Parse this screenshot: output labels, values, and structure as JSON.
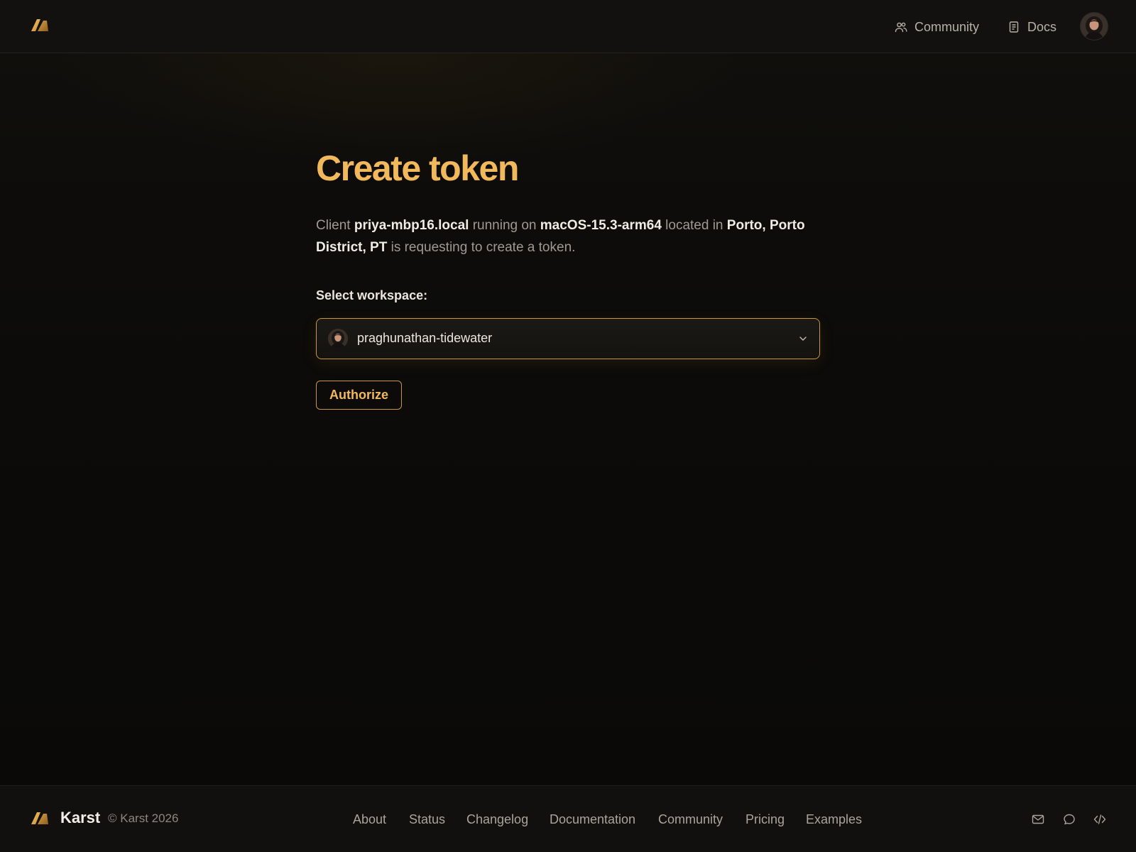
{
  "colors": {
    "accent": "#f2b95c",
    "accent_border": "#c9953f",
    "background": "#0c0b09",
    "header_bg": "#121110"
  },
  "header": {
    "logo_icon": "karst-logo-icon",
    "nav": [
      {
        "label": "Community",
        "icon": "people-icon"
      },
      {
        "label": "Docs",
        "icon": "document-icon"
      }
    ],
    "avatar_icon": "user-avatar"
  },
  "main": {
    "title": "Create token",
    "description": {
      "prefix": "Client ",
      "client": "priya-mbp16.local",
      "running_on": " running on ",
      "os": "macOS-15.3-arm64",
      "located_in": " located in ",
      "location": "Porto, Porto District, PT",
      "suffix": " is requesting to create a token."
    },
    "select_label": "Select workspace:",
    "workspace": {
      "selected": "praghunathan-tidewater",
      "icon": "chevron-down-icon"
    },
    "authorize_label": "Authorize"
  },
  "footer": {
    "brand": "Karst",
    "copyright": "© Karst 2026",
    "links": [
      "About",
      "Status",
      "Changelog",
      "Documentation",
      "Community",
      "Pricing",
      "Examples"
    ],
    "icons": [
      "mail-icon",
      "chat-icon",
      "code-icon"
    ]
  }
}
